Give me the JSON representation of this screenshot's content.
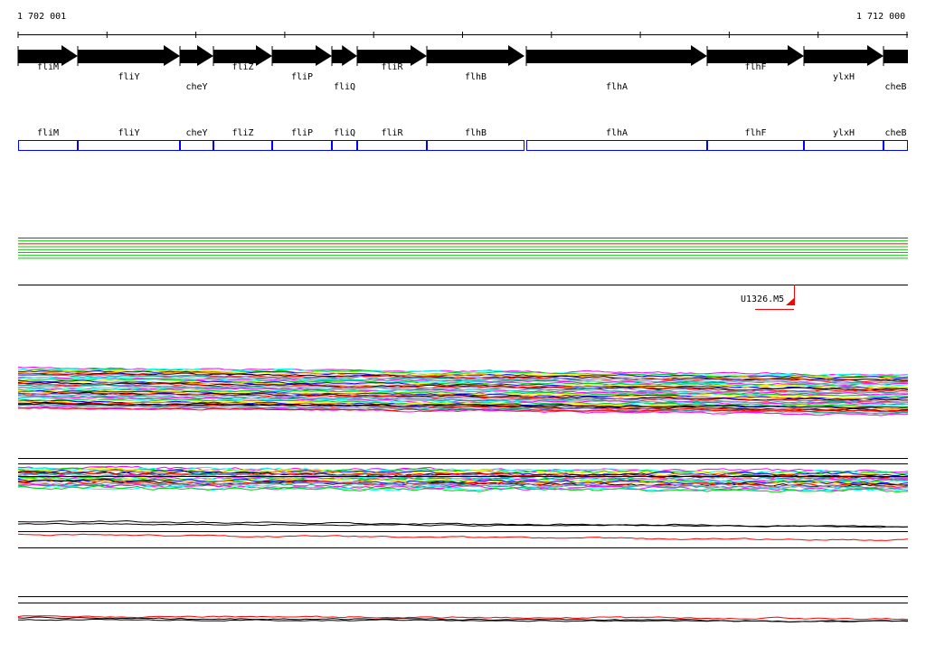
{
  "scale": {
    "start_label": "1 702 001",
    "end_label": "1 712 000"
  },
  "genes": [
    "fliM",
    "fliY",
    "cheY",
    "fliZ",
    "fliP",
    "fliQ",
    "fliR",
    "flhB",
    "flhA",
    "flhF",
    "ylxH",
    "cheB"
  ],
  "marker": {
    "label": "U1326.M5",
    "color": "#ff0000"
  },
  "colors": {
    "gene_box": "#0000ff",
    "arrow": "#000000"
  }
}
